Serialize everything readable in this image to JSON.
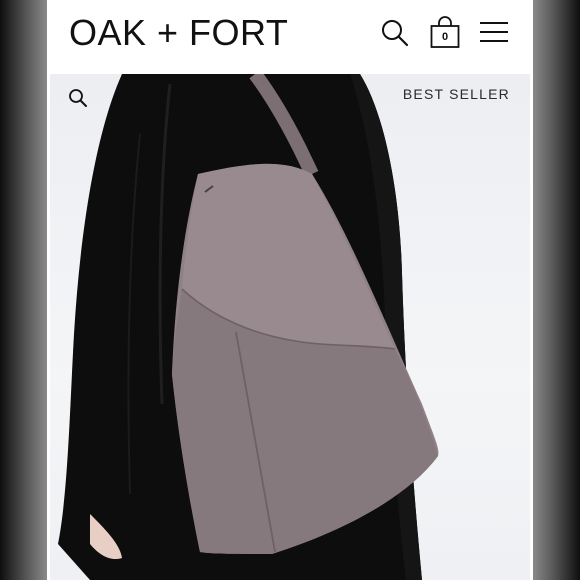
{
  "header": {
    "logo": "OAK + FORT",
    "cart_count": "0",
    "icons": [
      "search-icon",
      "shopping-bag-icon",
      "menu-icon"
    ]
  },
  "product": {
    "badge": "BEST SELLER",
    "zoom_icon": "magnify-icon",
    "image_description_hidden": null
  },
  "colors": {
    "background": "#ffffff",
    "text": "#111111",
    "bag": "#8f8186",
    "coat": "#0d0d0d"
  }
}
